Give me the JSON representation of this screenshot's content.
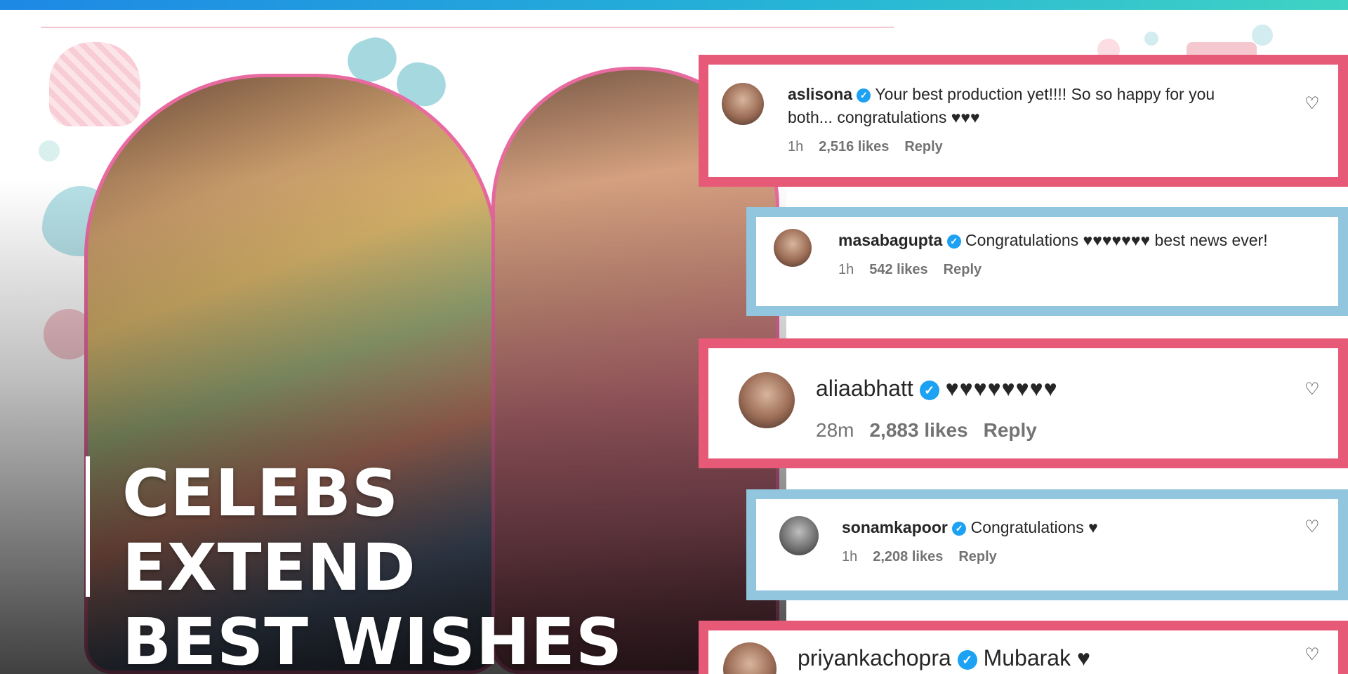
{
  "headline": {
    "line1": "CELEBS EXTEND",
    "line2": "BEST WISHES"
  },
  "comments": [
    {
      "username": "aslisona",
      "text_line1": "Your best production yet!!!! So so happy for you",
      "text_line2": "both... congratulations ♥♥♥",
      "time": "1h",
      "likes": "2,516 likes",
      "reply": "Reply",
      "frame_color": "#e65a78"
    },
    {
      "username": "masabagupta",
      "text_line1": "Congratulations ♥♥♥♥♥♥♥ best news ever!",
      "time": "1h",
      "likes": "542 likes",
      "reply": "Reply",
      "frame_color": "#92c6de"
    },
    {
      "username": "aliaabhatt",
      "text_line1": "♥♥♥♥♥♥♥♥",
      "time": "28m",
      "likes": "2,883 likes",
      "reply": "Reply",
      "frame_color": "#e65a78"
    },
    {
      "username": "sonamkapoor",
      "text_line1": "Congratulations ♥",
      "time": "1h",
      "likes": "2,208 likes",
      "reply": "Reply",
      "frame_color": "#92c6de"
    },
    {
      "username": "priyankachopra",
      "text_line1": "Mubarak ♥",
      "frame_color": "#e65a78"
    }
  ],
  "icons": {
    "verified": "verified-badge-icon",
    "like": "heart-outline-icon"
  },
  "colors": {
    "accent_pink": "#e65a78",
    "accent_blue": "#92c6de",
    "verified_blue": "#1da1f2",
    "top_bar_start": "#1e88e5",
    "top_bar_end": "#3fd3c4"
  }
}
